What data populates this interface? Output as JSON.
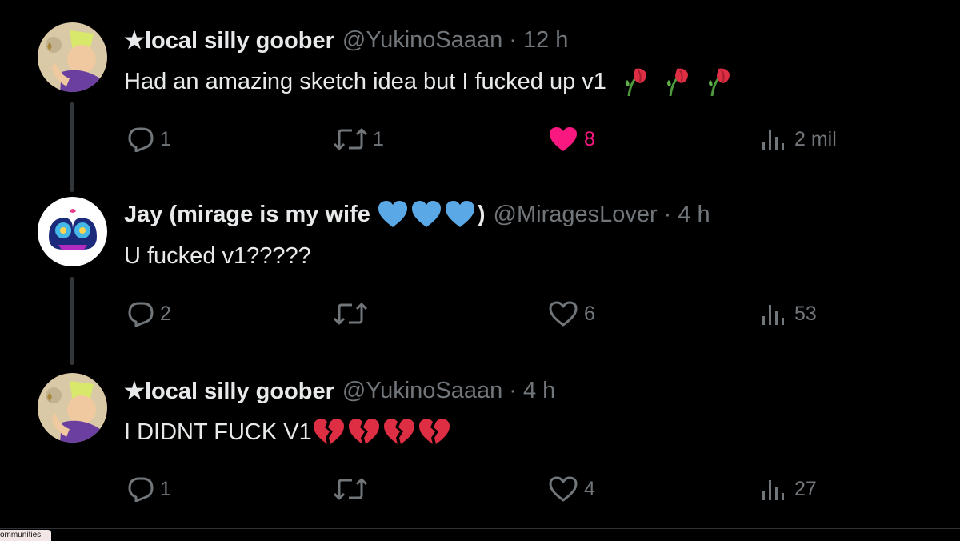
{
  "tweets": [
    {
      "display_name": "★local silly goober",
      "handle": "@YukinoSaaan",
      "dot": "·",
      "time": "12 h",
      "text": "Had an amazing sketch idea but I fucked up v1",
      "emojis": [
        "wilted-flower-icon",
        "wilted-flower-icon",
        "wilted-flower-icon"
      ],
      "replies": "1",
      "reposts": "1",
      "likes": "8",
      "liked": true,
      "views": "2 mil"
    },
    {
      "display_name": "Jay (mirage is my wife",
      "name_suffix": ")",
      "name_emojis": [
        "blue-heart-icon",
        "blue-heart-icon",
        "blue-heart-icon"
      ],
      "handle": "@MiragesLover",
      "dot": "·",
      "time": "4 h",
      "text": "U fucked v1?????",
      "replies": "2",
      "reposts": "",
      "likes": "6",
      "liked": false,
      "views": "53"
    },
    {
      "display_name": "★local silly goober",
      "handle": "@YukinoSaaan",
      "dot": "·",
      "time": "4 h",
      "text": "I DIDNT FUCK V1",
      "emojis": [
        "broken-heart-icon",
        "broken-heart-icon",
        "broken-heart-icon",
        "broken-heart-icon"
      ],
      "replies": "1",
      "reposts": "",
      "likes": "4",
      "liked": false,
      "views": "27"
    }
  ],
  "footer": {
    "tab_label": "ommunities"
  },
  "colors": {
    "background": "#000000",
    "muted": "#71767b",
    "like": "#f91880",
    "blue_heart": "#5aa9e6",
    "broken_heart": "#dd2e44"
  }
}
